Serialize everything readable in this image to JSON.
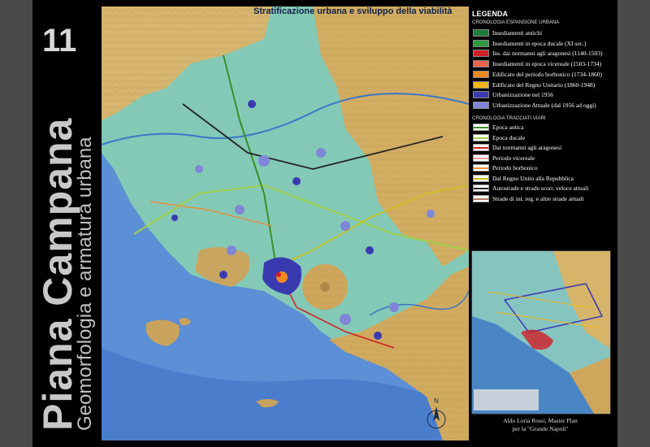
{
  "plate": {
    "number": "11"
  },
  "sidebar": {
    "title": "Piana Campana",
    "subtitle": "Geomorfologia e armatura urbana"
  },
  "map": {
    "title": "Stratificazione urbana e sviluppo della viabilità"
  },
  "legend": {
    "title": "LEGENDA",
    "urban_section_title": "CRONOLOGIA ESPANSIONE URBANA",
    "urban_items": [
      {
        "label": "Insediamenti antichi",
        "color": "#1e7b3a"
      },
      {
        "label": "Insediamenti in epoca ducale (XI sec.)",
        "color": "#2f9a3e"
      },
      {
        "label": "Ins. dai normanni agli aragonesi (1140-1503)",
        "color": "#d11f26"
      },
      {
        "label": "Insediamenti in epoca vicereale (1503-1734)",
        "color": "#e8654a"
      },
      {
        "label": "Edificato del periodo borbonico (1734-1860)",
        "color": "#ef8a22"
      },
      {
        "label": "Edificato del Regno Unitario (1860-1948)",
        "color": "#f2b51c"
      },
      {
        "label": "Urbanizzazione nel 1956",
        "color": "#3a3ab0"
      },
      {
        "label": "Urbanizzazione Attuale (dal 1956 ad oggi)",
        "color": "#7f86d8"
      }
    ],
    "roads_section_title": "CRONOLOGIA TRACCIATI VIARI",
    "road_items": [
      {
        "label": "Epoca antica",
        "color": "#3a8f2a"
      },
      {
        "label": "Epoca ducale",
        "color": "#9fd04a"
      },
      {
        "label": "Dai normanni agli aragonesi",
        "color": "#d11f26"
      },
      {
        "label": "Periodo vicereale",
        "color": "#f0a0a0"
      },
      {
        "label": "Periodo borbonico",
        "color": "#f08c3a"
      },
      {
        "label": "Dal Regno Unito alla Repubblica",
        "color": "#c8c020"
      },
      {
        "label": "Autostrade e strade scorr. veloce attuali",
        "color": "#222222"
      },
      {
        "label": "Strade di int. reg. e altre strade attuali",
        "color": "#b07a5a"
      }
    ]
  },
  "credit": {
    "line1": "Aldo Loria Rossi,  Master Plan",
    "line2": "per la \"Grande Napoli\""
  },
  "compass": {
    "label": "N"
  }
}
